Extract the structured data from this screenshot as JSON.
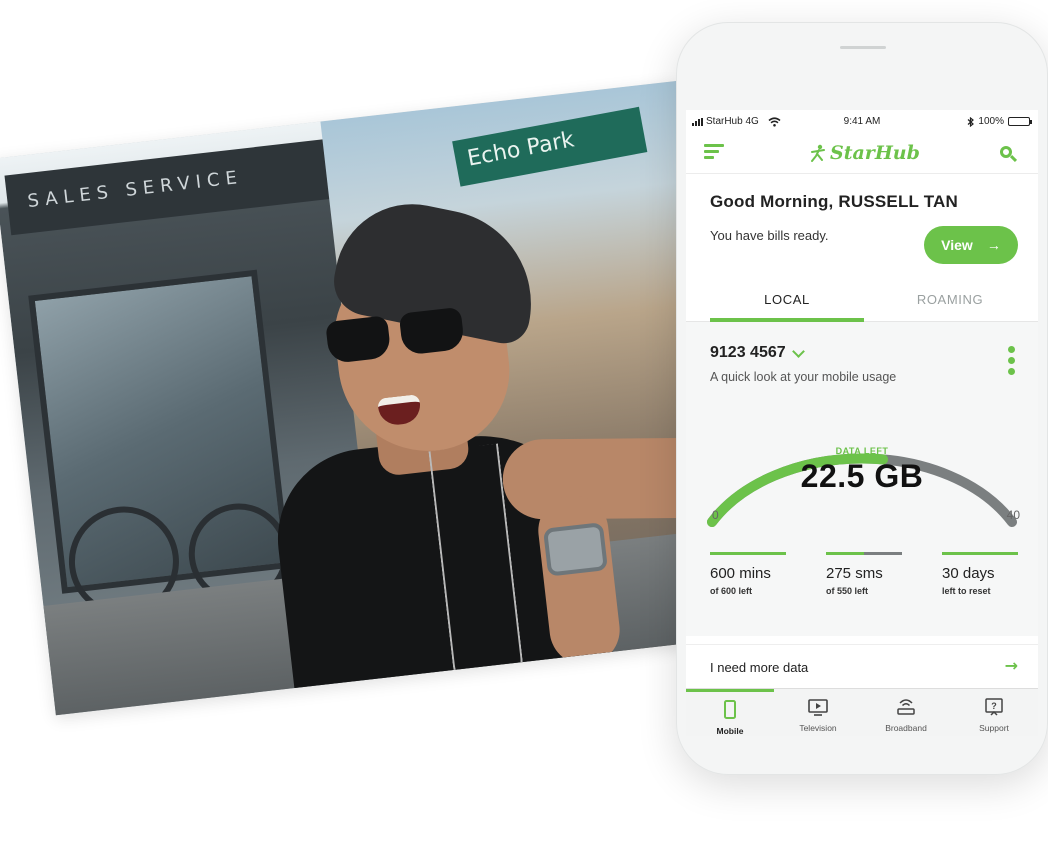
{
  "photo": {
    "storefront_sign": "SALES SERVICE",
    "street_sign": "Echo Park"
  },
  "statusbar": {
    "carrier": "StarHub 4G",
    "time": "9:41 AM",
    "battery": "100%"
  },
  "header": {
    "logo_text": "StarHub",
    "menu_icon": "menu-icon",
    "search_icon": "search-icon"
  },
  "greeting": {
    "title": "Good Morning, RUSSELL TAN",
    "subtitle": "You have bills ready.",
    "view_label": "View",
    "view_arrow": "→"
  },
  "tabs": {
    "local": "LOCAL",
    "roaming": "ROAMING",
    "active": "LOCAL"
  },
  "usage": {
    "number": "9123 4567",
    "subtitle": "A quick look at your mobile usage",
    "data_left_label": "DATA LEFT",
    "data_left_value": "22.5 GB",
    "gauge_min": "0",
    "gauge_max": "40",
    "gauge_fraction": 0.5625,
    "stats": [
      {
        "big": "600 mins",
        "small": "of 600 left",
        "fraction": 1.0
      },
      {
        "big": "275 sms",
        "small": "of 550 left",
        "fraction": 0.5
      },
      {
        "big": "30 days",
        "small": "left to reset",
        "fraction": 1.0
      }
    ]
  },
  "more_data": {
    "label": "I need more data",
    "arrow": "→"
  },
  "tabbar": {
    "items": [
      {
        "label": "Mobile",
        "icon": "mobile-icon",
        "active": true
      },
      {
        "label": "Television",
        "icon": "television-icon",
        "active": false
      },
      {
        "label": "Broadband",
        "icon": "broadband-icon",
        "active": false
      },
      {
        "label": "Support",
        "icon": "support-icon",
        "active": false
      }
    ]
  },
  "colors": {
    "accent": "#6cc24a",
    "track": "#7b7f80",
    "text": "#222222"
  }
}
